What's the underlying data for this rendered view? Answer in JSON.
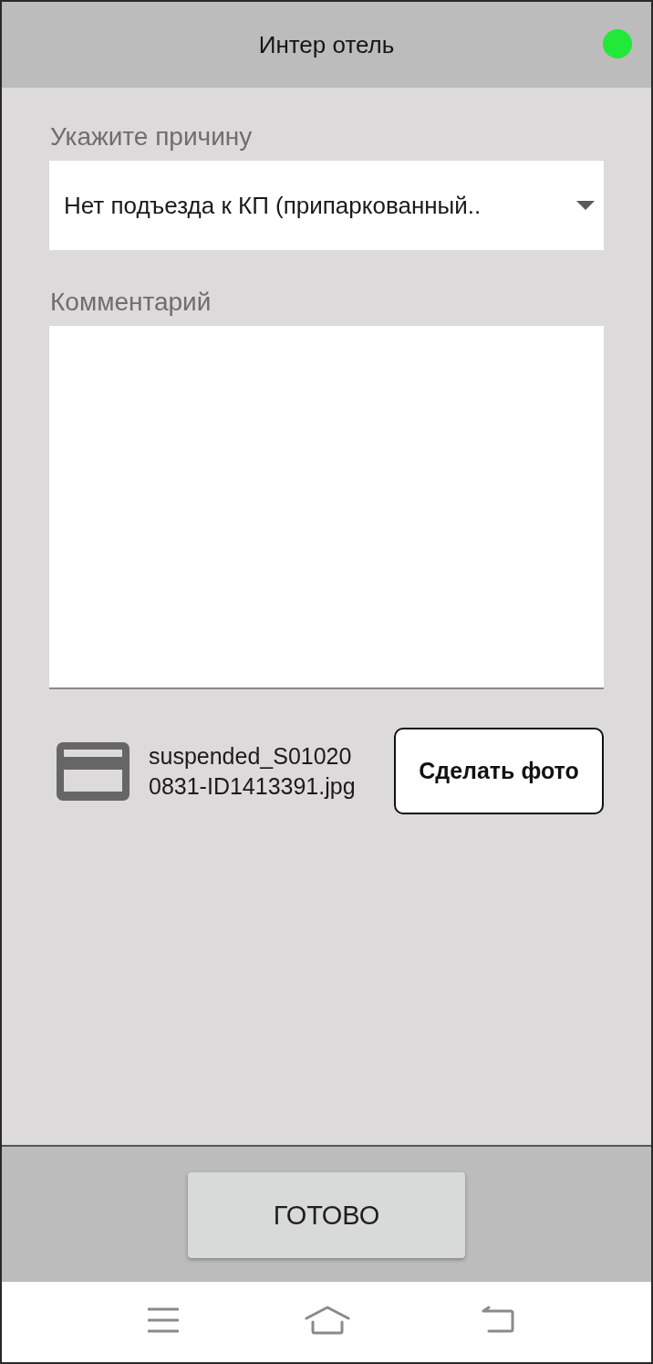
{
  "header": {
    "title": "Интер отель",
    "online": true
  },
  "reason": {
    "label": "Укажите причину",
    "value": "Нет подъезда к КП (припаркованный.."
  },
  "comment": {
    "label": "Комментарий"
  },
  "attachment": {
    "file_name": "suspended_S010200831-ID1413391.jpg",
    "button": "Сделать фото"
  },
  "footer": {
    "button": "ГОТОВО"
  }
}
